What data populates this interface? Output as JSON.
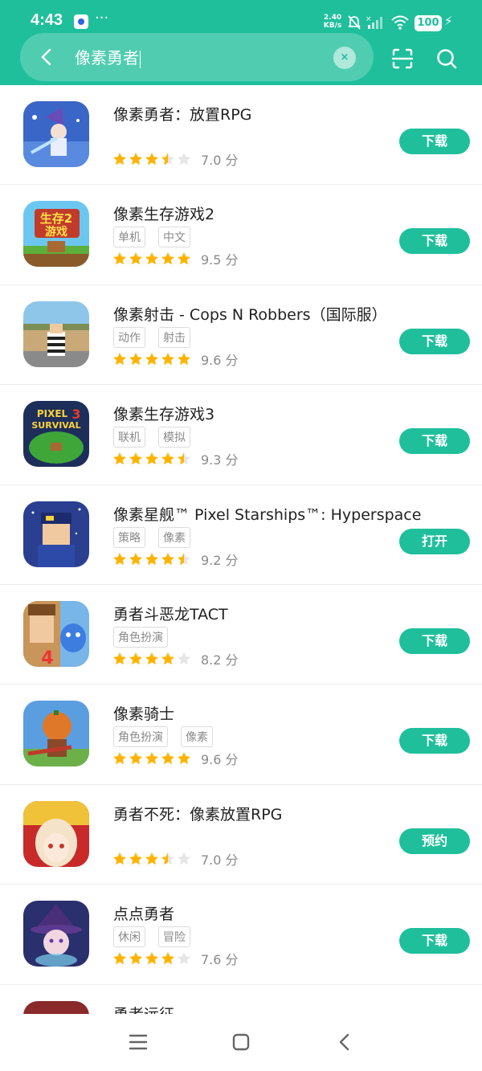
{
  "status_bar": {
    "time": "4:43",
    "more": "···",
    "net_speed_value": "2.40",
    "net_speed_unit": "KB/s",
    "battery": "100"
  },
  "search": {
    "query": "像素勇者",
    "clear_label": "×"
  },
  "colors": {
    "accent": "#1fbf9c",
    "star": "#ffb300",
    "star_empty": "#e6e6e6"
  },
  "results": [
    {
      "name": "像素勇者：放置RPG",
      "tags": [],
      "rating": 3.5,
      "score": "7.0 分",
      "action": "下载"
    },
    {
      "name": "像素生存游戏2",
      "tags": [
        "单机",
        "中文"
      ],
      "rating": 5,
      "score": "9.5 分",
      "action": "下载"
    },
    {
      "name": "像素射击 - Cops N Robbers（国际服）",
      "tags": [
        "动作",
        "射击"
      ],
      "rating": 5,
      "score": "9.6 分",
      "action": "下载"
    },
    {
      "name": "像素生存游戏3",
      "tags": [
        "联机",
        "模拟"
      ],
      "rating": 4.5,
      "score": "9.3 分",
      "action": "下载"
    },
    {
      "name": "像素星舰™ Pixel Starships™: Hyperspace",
      "tags": [
        "策略",
        "像素"
      ],
      "rating": 4.5,
      "score": "9.2 分",
      "action": "打开"
    },
    {
      "name": "勇者斗恶龙TACT",
      "tags": [
        "角色扮演"
      ],
      "rating": 4,
      "score": "8.2 分",
      "action": "下载"
    },
    {
      "name": "像素骑士",
      "tags": [
        "角色扮演",
        "像素"
      ],
      "rating": 5,
      "score": "9.6 分",
      "action": "下载"
    },
    {
      "name": "勇者不死：像素放置RPG",
      "tags": [],
      "rating": 3.5,
      "score": "7.0 分",
      "action": "预约"
    },
    {
      "name": "点点勇者",
      "tags": [
        "休闲",
        "冒险"
      ],
      "rating": 4,
      "score": "7.6 分",
      "action": "下载"
    },
    {
      "name": "勇者远征",
      "tags": [],
      "rating": 0,
      "score": "",
      "action": ""
    }
  ],
  "icons": {
    "back": "back-arrow-icon",
    "scan": "scan-icon",
    "search": "search-icon",
    "nav_menu": "menu-icon",
    "nav_home": "home-icon",
    "nav_back": "back-icon"
  }
}
